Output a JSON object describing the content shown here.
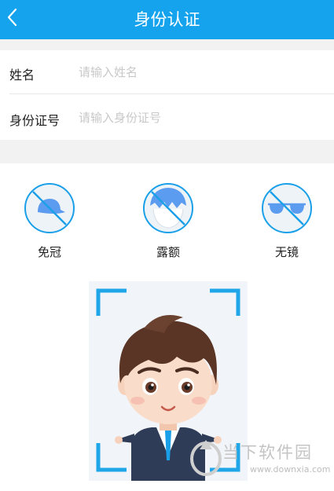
{
  "header": {
    "title": "身份认证",
    "back_icon": "chevron-left-icon"
  },
  "form": {
    "name": {
      "label": "姓名",
      "placeholder": "请输入姓名",
      "value": ""
    },
    "id_number": {
      "label": "身份证号",
      "placeholder": "请输入身份证号",
      "value": ""
    }
  },
  "requirements": [
    {
      "label": "免冠",
      "icon": "no-hat-icon"
    },
    {
      "label": "露额",
      "icon": "show-forehead-icon"
    },
    {
      "label": "无镜",
      "icon": "no-glasses-icon"
    }
  ],
  "watermark": {
    "text": "当下软件园",
    "url": "www.downxia.com"
  },
  "colors": {
    "primary": "#14a3ec",
    "icon_blue": "#5b9cf0",
    "background_gray": "#f2f2f2"
  }
}
